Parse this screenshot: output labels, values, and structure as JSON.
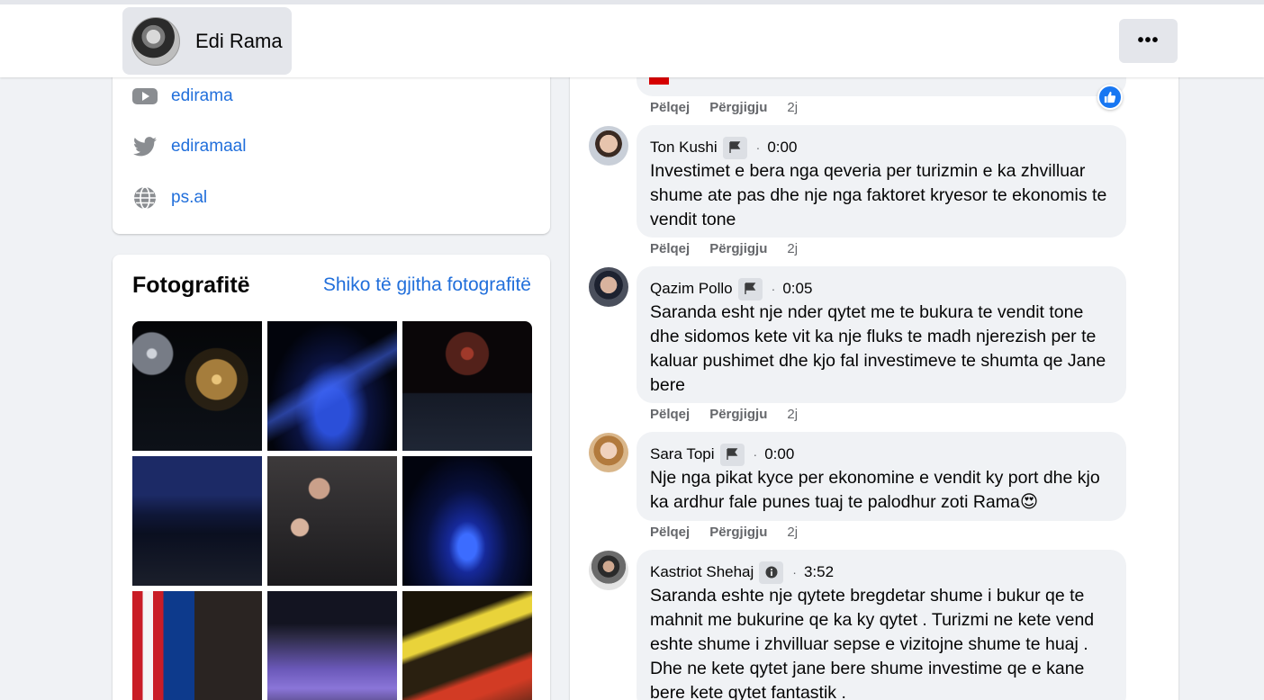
{
  "header": {
    "profile_name": "Edi Rama",
    "more_label": "•••"
  },
  "intro": {
    "links": [
      {
        "icon": "youtube-icon",
        "text": "edirama"
      },
      {
        "icon": "twitter-icon",
        "text": "ediramaal"
      },
      {
        "icon": "globe-icon",
        "text": "ps.al"
      }
    ]
  },
  "photos": {
    "title": "Fotografitë",
    "see_all": "Shiko të gjitha fotografitë"
  },
  "comment_actions": {
    "like": "Pëlqej",
    "reply": "Përgjigju",
    "age": "2j"
  },
  "comments": [
    {
      "author": "Ton Kushi",
      "badge_icon": "flag-icon",
      "timestamp": "0:00",
      "text": "Investimet e bera nga qeveria per turizmin e ka zhvilluar shume ate pas dhe nje nga faktoret kryesor te ekonomis te vendit tone"
    },
    {
      "author": "Qazim Pollo",
      "badge_icon": "flag-icon",
      "timestamp": "0:05",
      "text": "Saranda esht nje nder qytet me te bukura te vendit tone dhe sidomos kete vit ka nje fluks te madh njerezish per te kaluar pushimet dhe kjo fal investimeve te shumta qe Jane bere"
    },
    {
      "author": "Sara Topi",
      "badge_icon": "flag-icon",
      "timestamp": "0:00",
      "text": "Nje nga pikat kyce per ekonomine e vendit ky port dhe kjo ka ardhur fale punes tuaj te palodhur zoti Rama😍"
    },
    {
      "author": "Kastriot Shehaj",
      "badge_icon": "info-icon",
      "timestamp": "3:52",
      "text": "Saranda eshte nje qytete bregdetar shume i bukur qe te mahnit me bukurine qe ka ky qytet . Turizmi ne kete vend eshte shume i zhvilluar sepse e vizitojne shume te huaj . Dhe ne kete qytet jane bere shume investime qe e kane bere kete qytet fantastik ."
    }
  ],
  "colors": {
    "link": "#216fdb",
    "bubble": "#f0f2f5",
    "muted": "#65676b",
    "like_blue": "#1877f2"
  }
}
